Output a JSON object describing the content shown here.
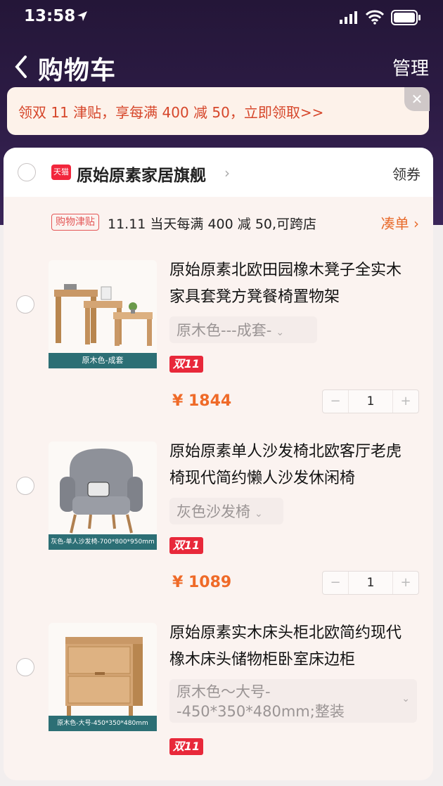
{
  "status_bar": {
    "time": "13:58"
  },
  "nav": {
    "title": "购物车",
    "manage_label": "管理"
  },
  "promo": {
    "text": "领双 11 津贴，享每满 400 减 50，立即领取>>",
    "close_glyph": "✕"
  },
  "store": {
    "badge": "天猫",
    "name": "原始原素家居旗舰",
    "coupon_label": "领券",
    "subsidy_badge": "购物津贴",
    "subsidy_text": "11.11 当天每满 400 减 50,可跨店",
    "collect_label": "凑单 ›"
  },
  "items": [
    {
      "title": "原始原素北欧田园橡木凳子全实木家具套凳方凳餐椅置物架",
      "image_label": "原木色-成套",
      "sku": "原木色---成套-",
      "badge": "双11",
      "price": "¥ 1844",
      "qty": "1"
    },
    {
      "title": "原始原素单人沙发椅北欧客厅老虎椅现代简约懒人沙发休闲椅",
      "image_label": "灰色-单人沙发椅-700*800*950mm",
      "sku": "灰色沙发椅",
      "badge": "双11",
      "price": "¥ 1089",
      "qty": "1"
    },
    {
      "title": "原始原素实木床头柜北欧简约现代橡木床头储物柜卧室床边柜",
      "image_label": "原木色-大号-450*350*480mm",
      "sku": "原木色～大号--450*350*480mm;整装",
      "badge": "双11"
    }
  ],
  "stepper": {
    "minus": "−",
    "plus": "+"
  }
}
